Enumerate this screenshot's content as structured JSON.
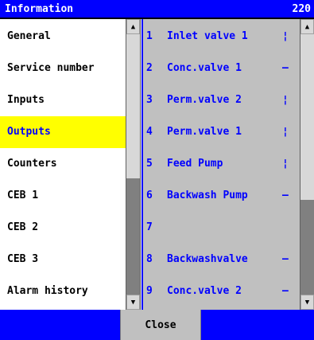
{
  "window": {
    "title": "Information",
    "code": "220"
  },
  "menu": [
    {
      "label": "General",
      "selected": false
    },
    {
      "label": "Service number",
      "selected": false
    },
    {
      "label": "Inputs",
      "selected": false
    },
    {
      "label": "Outputs",
      "selected": true
    },
    {
      "label": "Counters",
      "selected": false
    },
    {
      "label": "CEB 1",
      "selected": false
    },
    {
      "label": "CEB 2",
      "selected": false
    },
    {
      "label": "CEB 3",
      "selected": false
    },
    {
      "label": "Alarm history",
      "selected": false
    }
  ],
  "outputs": [
    {
      "num": "1",
      "label": "Inlet valve 1",
      "state": "¦"
    },
    {
      "num": "2",
      "label": "Conc.valve 1",
      "state": "–"
    },
    {
      "num": "3",
      "label": "Perm.valve 2",
      "state": "¦"
    },
    {
      "num": "4",
      "label": "Perm.valve 1",
      "state": "¦"
    },
    {
      "num": "5",
      "label": "Feed Pump",
      "state": "¦"
    },
    {
      "num": "6",
      "label": "Backwash Pump",
      "state": "–"
    },
    {
      "num": "7",
      "label": "",
      "state": ""
    },
    {
      "num": "8",
      "label": "Backwashvalve",
      "state": "–"
    },
    {
      "num": "9",
      "label": "Conc.valve 2",
      "state": "–"
    }
  ],
  "scroll": {
    "menu_position": 0.55,
    "outputs_position": 0.62,
    "up_icon": "triangle-up",
    "down_icon": "triangle-down"
  },
  "footer": {
    "close_label": "Close"
  },
  "colors": {
    "title_bar": "#0000ff",
    "selection": "#ffff00",
    "output_text": "#0000ff",
    "panel_bg": "#c0c0c0"
  }
}
